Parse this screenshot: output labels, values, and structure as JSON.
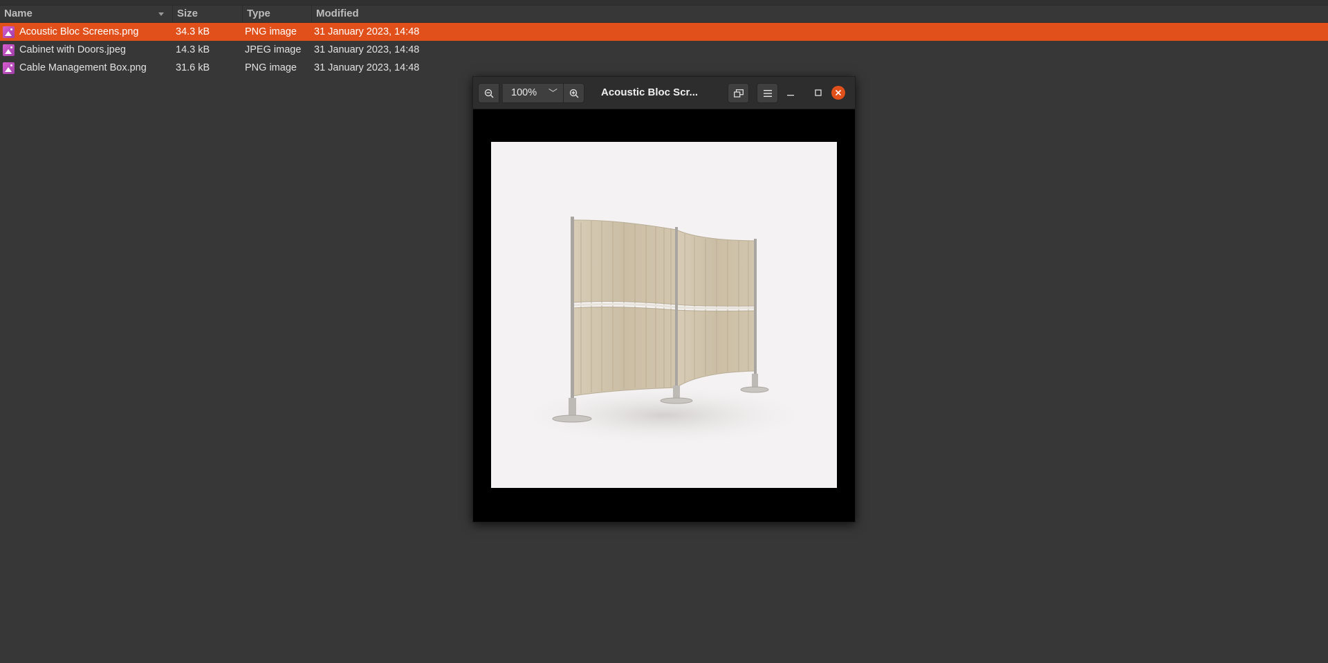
{
  "columns": {
    "name": "Name",
    "size": "Size",
    "type": "Type",
    "modified": "Modified"
  },
  "files": [
    {
      "name": "Acoustic Bloc Screens.png",
      "size": "34.3 kB",
      "type": "PNG image",
      "modified": "31 January 2023, 14:48",
      "selected": true
    },
    {
      "name": "Cabinet with Doors.jpeg",
      "size": "14.3 kB",
      "type": "JPEG image",
      "modified": "31 January 2023, 14:48",
      "selected": false
    },
    {
      "name": "Cable Management Box.png",
      "size": "31.6 kB",
      "type": "PNG image",
      "modified": "31 January 2023, 14:48",
      "selected": false
    }
  ],
  "viewer": {
    "title": "Acoustic Bloc Scr...",
    "zoom": "100%",
    "icons": {
      "zoom_out": "zoom-out-icon",
      "zoom_in": "zoom-in-icon",
      "zoom_menu": "chevron-down-icon",
      "view_mode": "window-mode-icon",
      "menu": "hamburger-menu-icon",
      "minimize": "minimize-icon",
      "maximize": "maximize-icon",
      "close": "close-icon"
    },
    "image_subject": "acoustic-screen-image"
  },
  "colors": {
    "accent": "#e1501b",
    "background": "#373737",
    "file_icon": "#c94fc3"
  }
}
